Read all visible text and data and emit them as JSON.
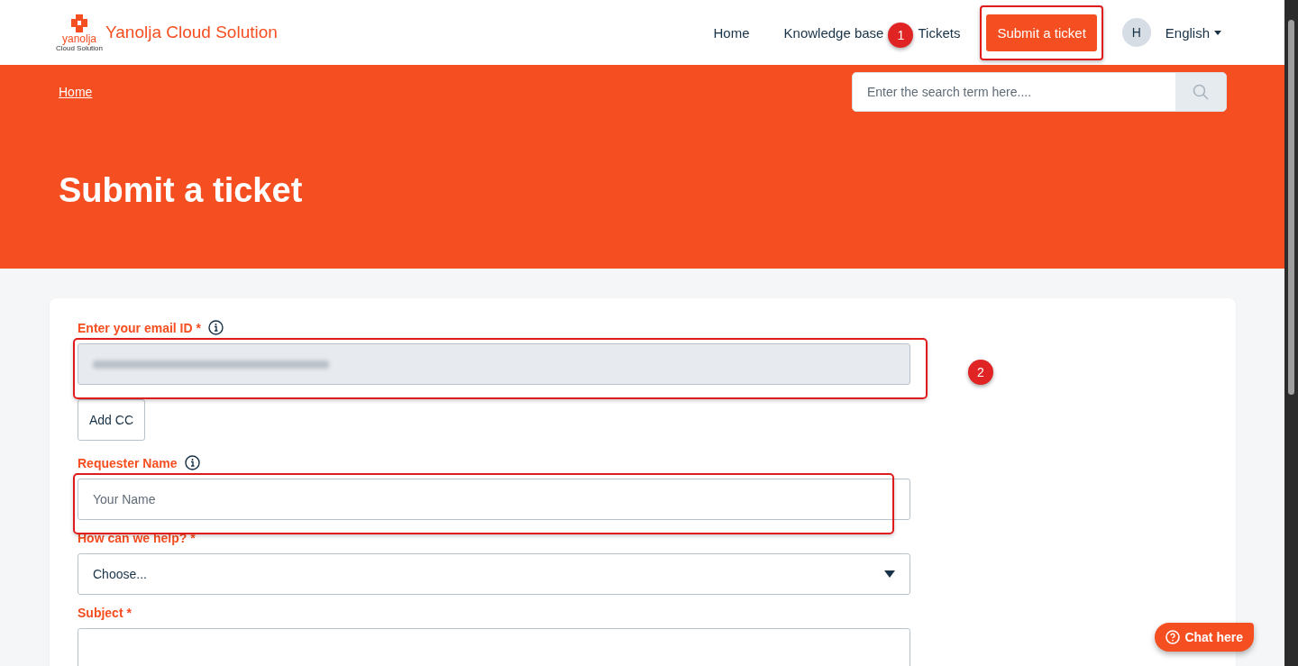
{
  "header": {
    "brand_mark": "yanolja",
    "brand_sub": "Cloud Solution",
    "brand_title": "Yanolja Cloud Solution",
    "nav": [
      {
        "label": "Home",
        "kind": "link"
      },
      {
        "label": "Knowledge base",
        "kind": "link"
      },
      {
        "label": "Tickets",
        "kind": "link"
      },
      {
        "label": "Submit a ticket",
        "kind": "button",
        "highlighted": true,
        "marker": "1"
      }
    ],
    "avatar": "H",
    "language": "English"
  },
  "banner": {
    "breadcrumb": "Home",
    "search": {
      "placeholder": "Enter the search term here...."
    },
    "title": "Submit a ticket"
  },
  "form": {
    "fields": [
      {
        "label": "Enter your email ID *",
        "info": true,
        "kind": "blurred",
        "highlighted": true,
        "marker": "2",
        "extra_button": "Add CC"
      },
      {
        "label": "Requester Name",
        "info": true,
        "kind": "text",
        "placeholder": "Your Name",
        "highlighted": true
      },
      {
        "label": "How can we help? *",
        "info": false,
        "kind": "select",
        "value": "Choose...",
        "highlighted": false
      },
      {
        "label": "Subject *",
        "info": false,
        "kind": "text",
        "highlighted": false
      }
    ]
  },
  "chat": {
    "label": "Chat here"
  }
}
